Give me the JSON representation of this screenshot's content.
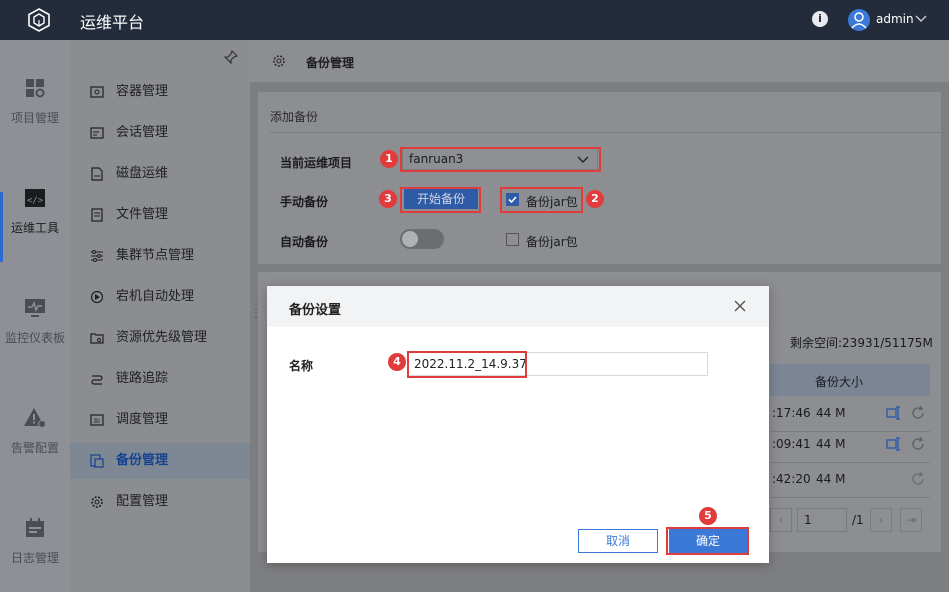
{
  "header": {
    "app_title": "运维平台",
    "user_name": "admin"
  },
  "rail": {
    "items": [
      {
        "label": "项目管理"
      },
      {
        "label": "运维工具"
      },
      {
        "label": "监控仪表板"
      },
      {
        "label": "告警配置"
      },
      {
        "label": "日志管理"
      }
    ]
  },
  "subnav": {
    "items": [
      {
        "label": "容器管理"
      },
      {
        "label": "会话管理"
      },
      {
        "label": "磁盘运维"
      },
      {
        "label": "文件管理"
      },
      {
        "label": "集群节点管理"
      },
      {
        "label": "宕机自动处理"
      },
      {
        "label": "资源优先级管理"
      },
      {
        "label": "链路追踪"
      },
      {
        "label": "调度管理"
      },
      {
        "label": "备份管理"
      },
      {
        "label": "配置管理"
      }
    ]
  },
  "page": {
    "title": "备份管理"
  },
  "add_backup": {
    "title": "添加备份",
    "project_label": "当前运维项目",
    "project_value": "fanruan3",
    "manual_label": "手动备份",
    "start_button": "开始备份",
    "jar_label": "备份jar包",
    "auto_label": "自动备份",
    "auto_jar_label": "备份jar包"
  },
  "backup_list": {
    "remaining_label": "剩余空间:",
    "remaining_value": "23931/51175M",
    "colon": ":",
    "size_header": "备份大小",
    "rows": [
      {
        "time": ":17:46",
        "size": "44 M"
      },
      {
        "time": ":09:41",
        "size": "44 M"
      },
      {
        "time": ":42:20",
        "size": "44 M"
      }
    ],
    "page_value": "1",
    "page_total": "/1"
  },
  "dialog": {
    "title": "备份设置",
    "name_label": "名称",
    "name_value": "2022.11.2_14.9.37",
    "cancel": "取消",
    "ok": "确定"
  },
  "annotations": [
    "1",
    "2",
    "3",
    "4",
    "5"
  ],
  "colors": {
    "accent": "#3a79d8",
    "annotation": "#e03c3c",
    "header": "#242c3b"
  }
}
